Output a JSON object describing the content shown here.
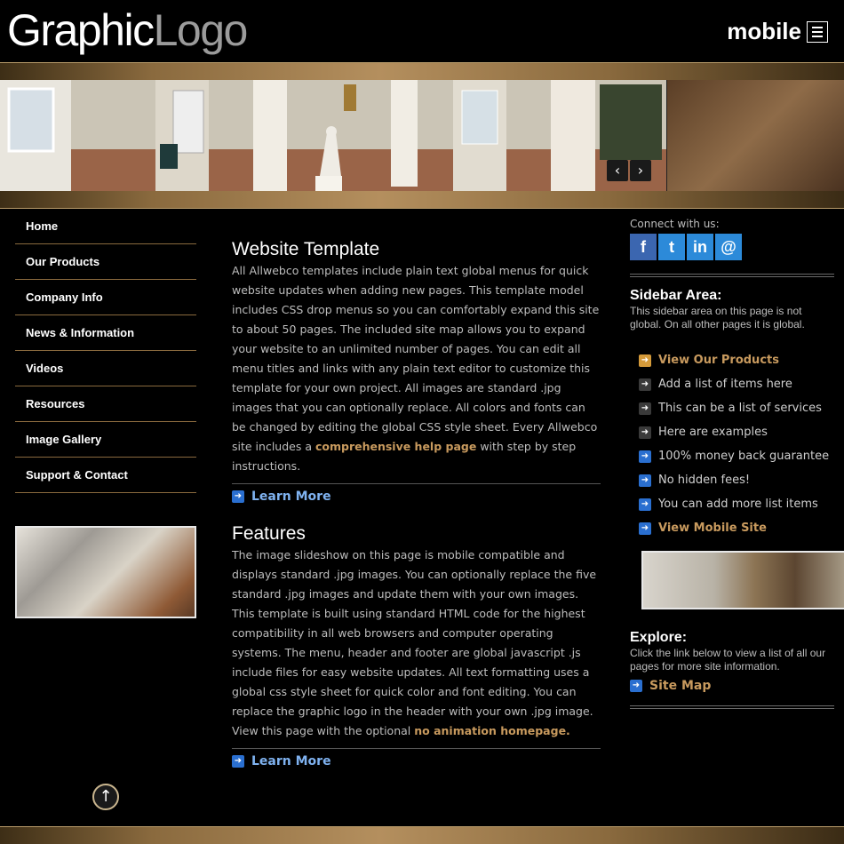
{
  "header": {
    "logo_primary": "Graphic",
    "logo_secondary": "Logo",
    "mobile_label": "mobile"
  },
  "slideshow": {
    "prev_icon": "‹",
    "next_icon": "›"
  },
  "nav": {
    "items": [
      {
        "label": "Home"
      },
      {
        "label": "Our Products"
      },
      {
        "label": "Company Info"
      },
      {
        "label": "News & Information"
      },
      {
        "label": "Videos"
      },
      {
        "label": "Resources"
      },
      {
        "label": "Image Gallery"
      },
      {
        "label": "Support & Contact"
      }
    ]
  },
  "main": {
    "sections": [
      {
        "title": "Website Template",
        "body_before": "All Allwebco templates include plain text global menus for quick website updates when adding new pages. This template model includes CSS drop menus so you can comfortably expand this site to about 50 pages. The included site map allows you to expand your website to an unlimited number of pages. You can edit all menu titles and links with any plain text editor to customize this template for your own project. All images are standard .jpg images that you can optionally replace. All colors and fonts can be changed by editing the global CSS style sheet. Every Allwebco site includes a ",
        "link": "comprehensive help page",
        "body_after": " with step by step instructions.",
        "learn_more": "Learn More"
      },
      {
        "title": "Features",
        "body_before": "The image slideshow on this page is mobile compatible and displays standard .jpg images. You can optionally replace the five standard .jpg images and update them with your own images. This template is built using standard HTML code for the highest compatibility in all web browsers and computer operating systems. The menu, header and footer are global javascript .js include files for easy website updates. All text formatting uses a global css style sheet for quick color and font editing. You can replace the graphic logo in the header with your own .jpg image. View this page with the optional ",
        "link": "no animation homepage.",
        "body_after": "",
        "learn_more": "Learn More"
      }
    ]
  },
  "sidebar": {
    "connect_label": "Connect with us:",
    "social": [
      {
        "icon": "facebook-icon",
        "glyph": "f"
      },
      {
        "icon": "twitter-icon",
        "glyph": "t"
      },
      {
        "icon": "linkedin-icon",
        "glyph": "in"
      },
      {
        "icon": "email-icon",
        "glyph": "@"
      }
    ],
    "area_title": "Sidebar Area:",
    "area_text": "This sidebar area on this page is not global. On all other pages it is global.",
    "list": [
      {
        "label": "View Our Products",
        "highlight": true,
        "icon": "orange"
      },
      {
        "label": "Add a list of items here",
        "highlight": false,
        "icon": "gray"
      },
      {
        "label": "This can be a list of services",
        "highlight": false,
        "icon": "gray"
      },
      {
        "label": "Here are examples",
        "highlight": false,
        "icon": "gray"
      },
      {
        "label": "100% money back guarantee",
        "highlight": false,
        "icon": "blue"
      },
      {
        "label": "No hidden fees!",
        "highlight": false,
        "icon": "blue"
      },
      {
        "label": "You can add more list items",
        "highlight": false,
        "icon": "blue"
      },
      {
        "label": "View Mobile Site",
        "highlight": true,
        "icon": "blue"
      }
    ],
    "explore_title": "Explore:",
    "explore_text": "Click the link below to view a list of all our pages for more site information.",
    "site_map": "Site Map"
  },
  "colors": {
    "accent_gold": "#c89a5e",
    "link_blue": "#7fb2f0",
    "background": "#000000"
  }
}
